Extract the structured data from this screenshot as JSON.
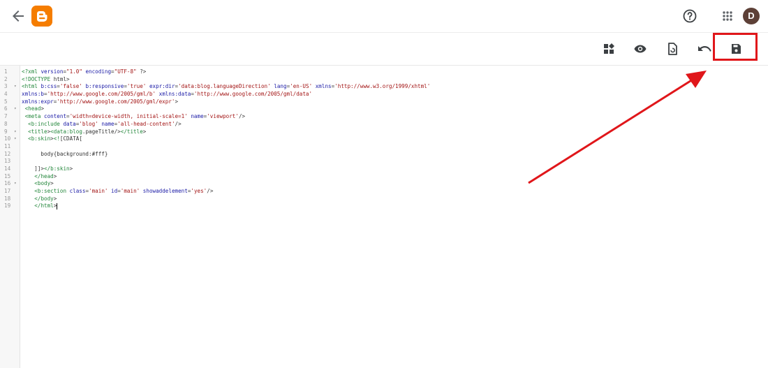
{
  "header": {
    "back_icon": "arrow-back-icon",
    "logo_icon": "blogger-logo-icon",
    "help_icon": "help-circle-icon",
    "apps_icon": "apps-grid-icon",
    "avatar_letter": "D"
  },
  "toolbar": {
    "icons": [
      "widget-icon",
      "preview-eye-icon",
      "format-document-icon",
      "undo-icon",
      "save-icon"
    ],
    "highlight_color": "#e0161a"
  },
  "editor": {
    "line_numbers": [
      "1",
      "2",
      "3",
      "4",
      "5",
      "6",
      "7",
      "8",
      "9",
      "10",
      "11",
      "12",
      "13",
      "14",
      "15",
      "16",
      "17",
      "18",
      "19"
    ],
    "folded_lines": [
      3,
      6,
      9,
      10,
      16
    ],
    "lines": [
      "<?xml version=\"1.0\" encoding=\"UTF-8\" ?>",
      "<!DOCTYPE html>",
      "<html b:css='false' b:responsive='true' expr:dir='data:blog.languageDirection' lang='en-US' xmlns='http://www.w3.org/1999/xhtml'",
      "xmlns:b='http://www.google.com/2005/gml/b' xmlns:data='http://www.google.com/2005/gml/data'",
      "xmlns:expr='http://www.google.com/2005/gml/expr'>",
      " <head>",
      " <meta content='width=device-width, initial-scale=1' name='viewport'/>",
      "  <b:include data='blog' name='all-head-content'/>",
      "  <title><data:blog.pageTitle/></title>",
      "  <b:skin><![CDATA[",
      "",
      "      body{background:#fff}",
      "",
      "    ]]></b:skin>",
      "    </head>",
      "    <body>",
      "    <b:section class='main' id='main' showaddelement='yes'/>",
      "    </body>",
      "    </html>"
    ]
  }
}
